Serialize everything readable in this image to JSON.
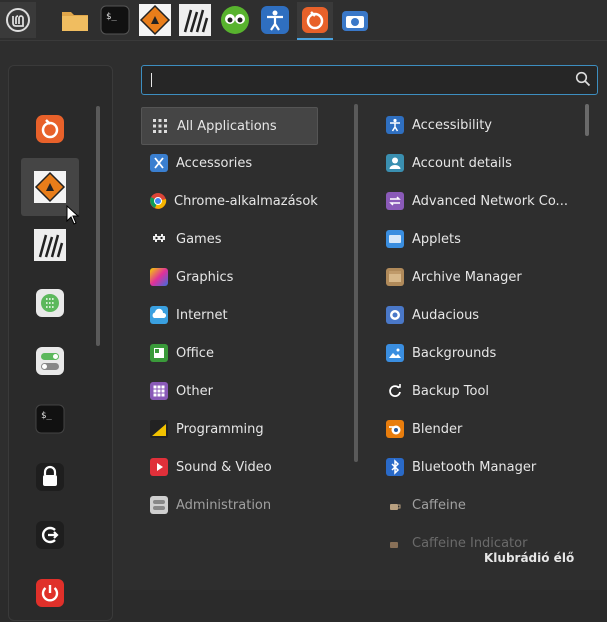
{
  "panel": {
    "launchers": [
      {
        "icon": "mint-menu-icon"
      },
      {
        "icon": "files-folder-icon"
      },
      {
        "icon": "terminal-icon"
      },
      {
        "icon": "klubradio-sign-icon"
      },
      {
        "icon": "zebra-icon"
      },
      {
        "icon": "owl-icon"
      },
      {
        "icon": "accessibility-icon"
      },
      {
        "icon": "firefox-icon"
      },
      {
        "icon": "camera-icon"
      }
    ]
  },
  "search": {
    "value": ""
  },
  "categories": [
    {
      "label": "All Applications",
      "icon": "grid-icon",
      "selected": true
    },
    {
      "label": "Accessories",
      "icon": "accessories-icon"
    },
    {
      "label": "Chrome-alkalmazások",
      "icon": "chrome-icon"
    },
    {
      "label": "Games",
      "icon": "games-icon"
    },
    {
      "label": "Graphics",
      "icon": "graphics-icon"
    },
    {
      "label": "Internet",
      "icon": "internet-icon"
    },
    {
      "label": "Office",
      "icon": "office-icon"
    },
    {
      "label": "Other",
      "icon": "other-icon"
    },
    {
      "label": "Programming",
      "icon": "programming-icon"
    },
    {
      "label": "Sound & Video",
      "icon": "sound-video-icon"
    },
    {
      "label": "Administration",
      "icon": "administration-icon",
      "dim": true
    }
  ],
  "apps": [
    {
      "label": "Accessibility",
      "icon": "accessibility-icon",
      "color": "#2f6fc0"
    },
    {
      "label": "Account details",
      "icon": "account-icon",
      "color": "#3a8fb0"
    },
    {
      "label": "Advanced Network Co...",
      "icon": "network-icon",
      "color": "#8a5ab8"
    },
    {
      "label": "Applets",
      "icon": "applets-icon",
      "color": "#3a8ee0"
    },
    {
      "label": "Archive Manager",
      "icon": "archive-icon",
      "color": "#b08a5a"
    },
    {
      "label": "Audacious",
      "icon": "audacious-icon",
      "color": "#4a78c8"
    },
    {
      "label": "Backgrounds",
      "icon": "backgrounds-icon",
      "color": "#3a8ee0"
    },
    {
      "label": "Backup Tool",
      "icon": "backup-icon",
      "color": "#2a2a2a"
    },
    {
      "label": "Blender",
      "icon": "blender-icon",
      "color": "#e87d0d"
    },
    {
      "label": "Bluetooth Manager",
      "icon": "bluetooth-icon",
      "color": "#2a6ac8"
    },
    {
      "label": "Caffeine",
      "icon": "caffeine-icon",
      "color": "#6a5a48",
      "dim": true
    },
    {
      "label": "Caffeine Indicator",
      "icon": "caffeine-indicator-icon",
      "color": "#6a5a48",
      "dimmer": true
    }
  ],
  "footer": {
    "label": "Klubrádió élő"
  }
}
